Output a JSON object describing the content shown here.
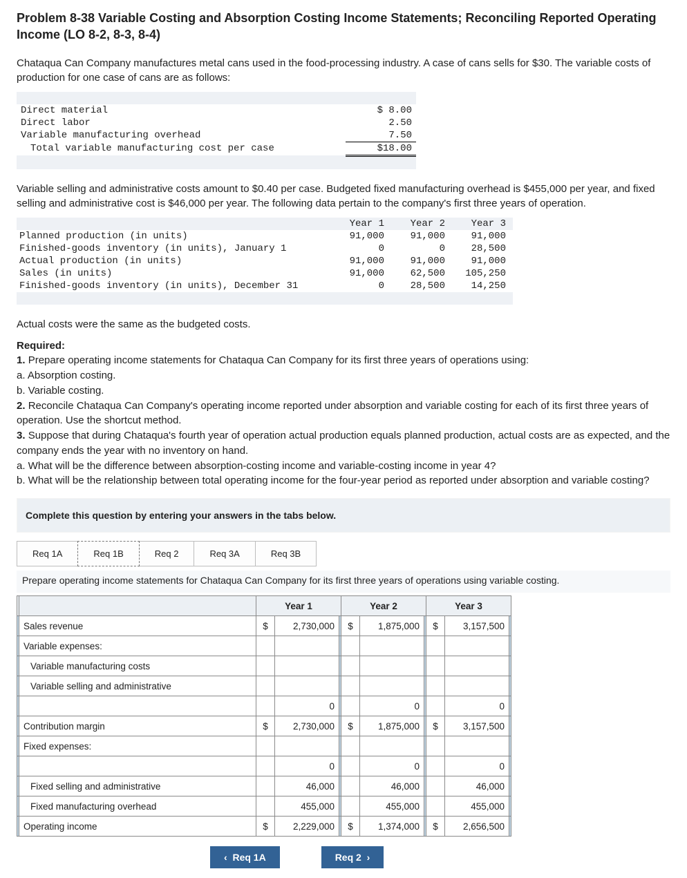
{
  "title": "Problem 8-38 Variable Costing and Absorption Costing Income Statements; Reconciling Reported Operating Income (LO 8-2, 8-3, 8-4)",
  "intro": "Chataqua Can Company manufactures metal cans used in the food-processing industry. A case of cans sells for $30. The variable costs of production for one case of cans are as follows:",
  "costs": {
    "dm_label": "Direct material",
    "dm_val": "$ 8.00",
    "dl_label": "Direct labor",
    "dl_val": "2.50",
    "vmoh_label": "Variable manufacturing overhead",
    "vmoh_val": "7.50",
    "tot_label": "Total variable manufacturing cost per case",
    "tot_val": "$18.00"
  },
  "para2": "Variable selling and administrative costs amount to $0.40 per case. Budgeted fixed manufacturing overhead is $455,000 per year, and fixed selling and administrative cost is $46,000 per year. The following data pertain to the company's first three years of operation.",
  "yrs": {
    "h1": "Year 1",
    "h2": "Year 2",
    "h3": "Year 3",
    "r1": {
      "l": "Planned production (in units)",
      "v": [
        "91,000",
        "91,000",
        "91,000"
      ]
    },
    "r2": {
      "l": "Finished-goods inventory (in units), January 1",
      "v": [
        "0",
        "0",
        "28,500"
      ]
    },
    "r3": {
      "l": "Actual production (in units)",
      "v": [
        "91,000",
        "91,000",
        "91,000"
      ]
    },
    "r4": {
      "l": "Sales (in units)",
      "v": [
        "91,000",
        "62,500",
        "105,250"
      ]
    },
    "r5": {
      "l": "Finished-goods inventory (in units), December 31",
      "v": [
        "0",
        "28,500",
        "14,250"
      ]
    }
  },
  "para3": "Actual costs were the same as the budgeted costs.",
  "reqheader": "Required:",
  "req1": "1. Prepare operating income statements for Chataqua Can Company for its first three years of operations using:",
  "req1a": "a. Absorption costing.",
  "req1b": "b. Variable costing.",
  "req2": "2. Reconcile Chataqua Can Company's operating income reported under absorption and variable costing for each of its first three years of operation. Use the shortcut method.",
  "req3": "3. Suppose that during Chataqua's fourth year of operation actual production equals planned production, actual costs are as expected, and the company ends the year with no inventory on hand.",
  "req3a": "a. What will be the difference between absorption-costing income and variable-costing income in year 4?",
  "req3b": "b. What will be the relationship between total operating income for the four-year period as reported under absorption and variable costing?",
  "instr": "Complete this question by entering your answers in the tabs below.",
  "tabs": {
    "t1": "Req 1A",
    "t2": "Req 1B",
    "t3": "Req 2",
    "t4": "Req 3A",
    "t5": "Req 3B"
  },
  "tabinstr": "Prepare operating income statements for Chataqua Can Company for its first three years of operations using variable costing.",
  "ans": {
    "h1": "Year 1",
    "h2": "Year 2",
    "h3": "Year 3",
    "rows": {
      "sales": {
        "l": "Sales revenue",
        "c": "$",
        "v": [
          "2,730,000",
          "1,875,000",
          "3,157,500"
        ]
      },
      "ve": {
        "l": "Variable expenses:"
      },
      "vmc": {
        "l": "Variable manufacturing costs"
      },
      "vsa": {
        "l": "Variable selling and administrative"
      },
      "blank1": {
        "l": "",
        "v": [
          "0",
          "0",
          "0"
        ]
      },
      "cm": {
        "l": "Contribution margin",
        "c": "$",
        "v": [
          "2,730,000",
          "1,875,000",
          "3,157,500"
        ]
      },
      "fe": {
        "l": "Fixed expenses:"
      },
      "blank2": {
        "l": "",
        "v": [
          "0",
          "0",
          "0"
        ]
      },
      "fsa": {
        "l": "Fixed selling and administrative",
        "v": [
          "46,000",
          "46,000",
          "46,000"
        ]
      },
      "fmoh": {
        "l": "Fixed manufacturing overhead",
        "v": [
          "455,000",
          "455,000",
          "455,000"
        ]
      },
      "oi": {
        "l": "Operating income",
        "c": "$",
        "v": [
          "2,229,000",
          "1,374,000",
          "2,656,500"
        ]
      }
    }
  },
  "nav": {
    "prev": "Req 1A",
    "next": "Req 2"
  }
}
